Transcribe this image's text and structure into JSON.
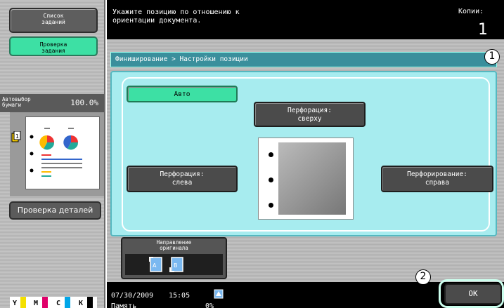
{
  "left_panel": {
    "job_list": "Список\nзаданий",
    "job_check": "Проверка\nзадания",
    "paper_auto": "Автовыбор\nбумаги",
    "zoom": "100.0%",
    "details_button": "Проверка деталей",
    "toner": [
      "Y",
      "M",
      "C",
      "K"
    ],
    "toner_colors": [
      "#f4e000",
      "#e0006a",
      "#00a6e8",
      "#000000"
    ]
  },
  "header": {
    "message": "Укажите позицию по отношению к\nориентации документа.",
    "copies_label": "Копии:",
    "copies_value": "1"
  },
  "main": {
    "breadcrumb": "Финиширование > Настройки позиции",
    "auto": "Авто",
    "punch_top": "Перфорация:\nсверху",
    "punch_left": "Перфорация:\nслева",
    "punch_right": "Перфорирование:\nсправа",
    "original_direction": "Направление\nоригинала"
  },
  "footer": {
    "date": "07/30/2009",
    "time": "15:05",
    "memory_label": "Память",
    "memory_value": "0%",
    "ok": "OK"
  },
  "callouts": [
    "1",
    "2"
  ],
  "colors": {
    "accent": "#3de0a4",
    "panel": "#a7ecef",
    "titlebar": "#3a8f9c"
  },
  "icons": [
    "network-icon",
    "orientation-portrait-icon",
    "orientation-landscape-icon"
  ]
}
